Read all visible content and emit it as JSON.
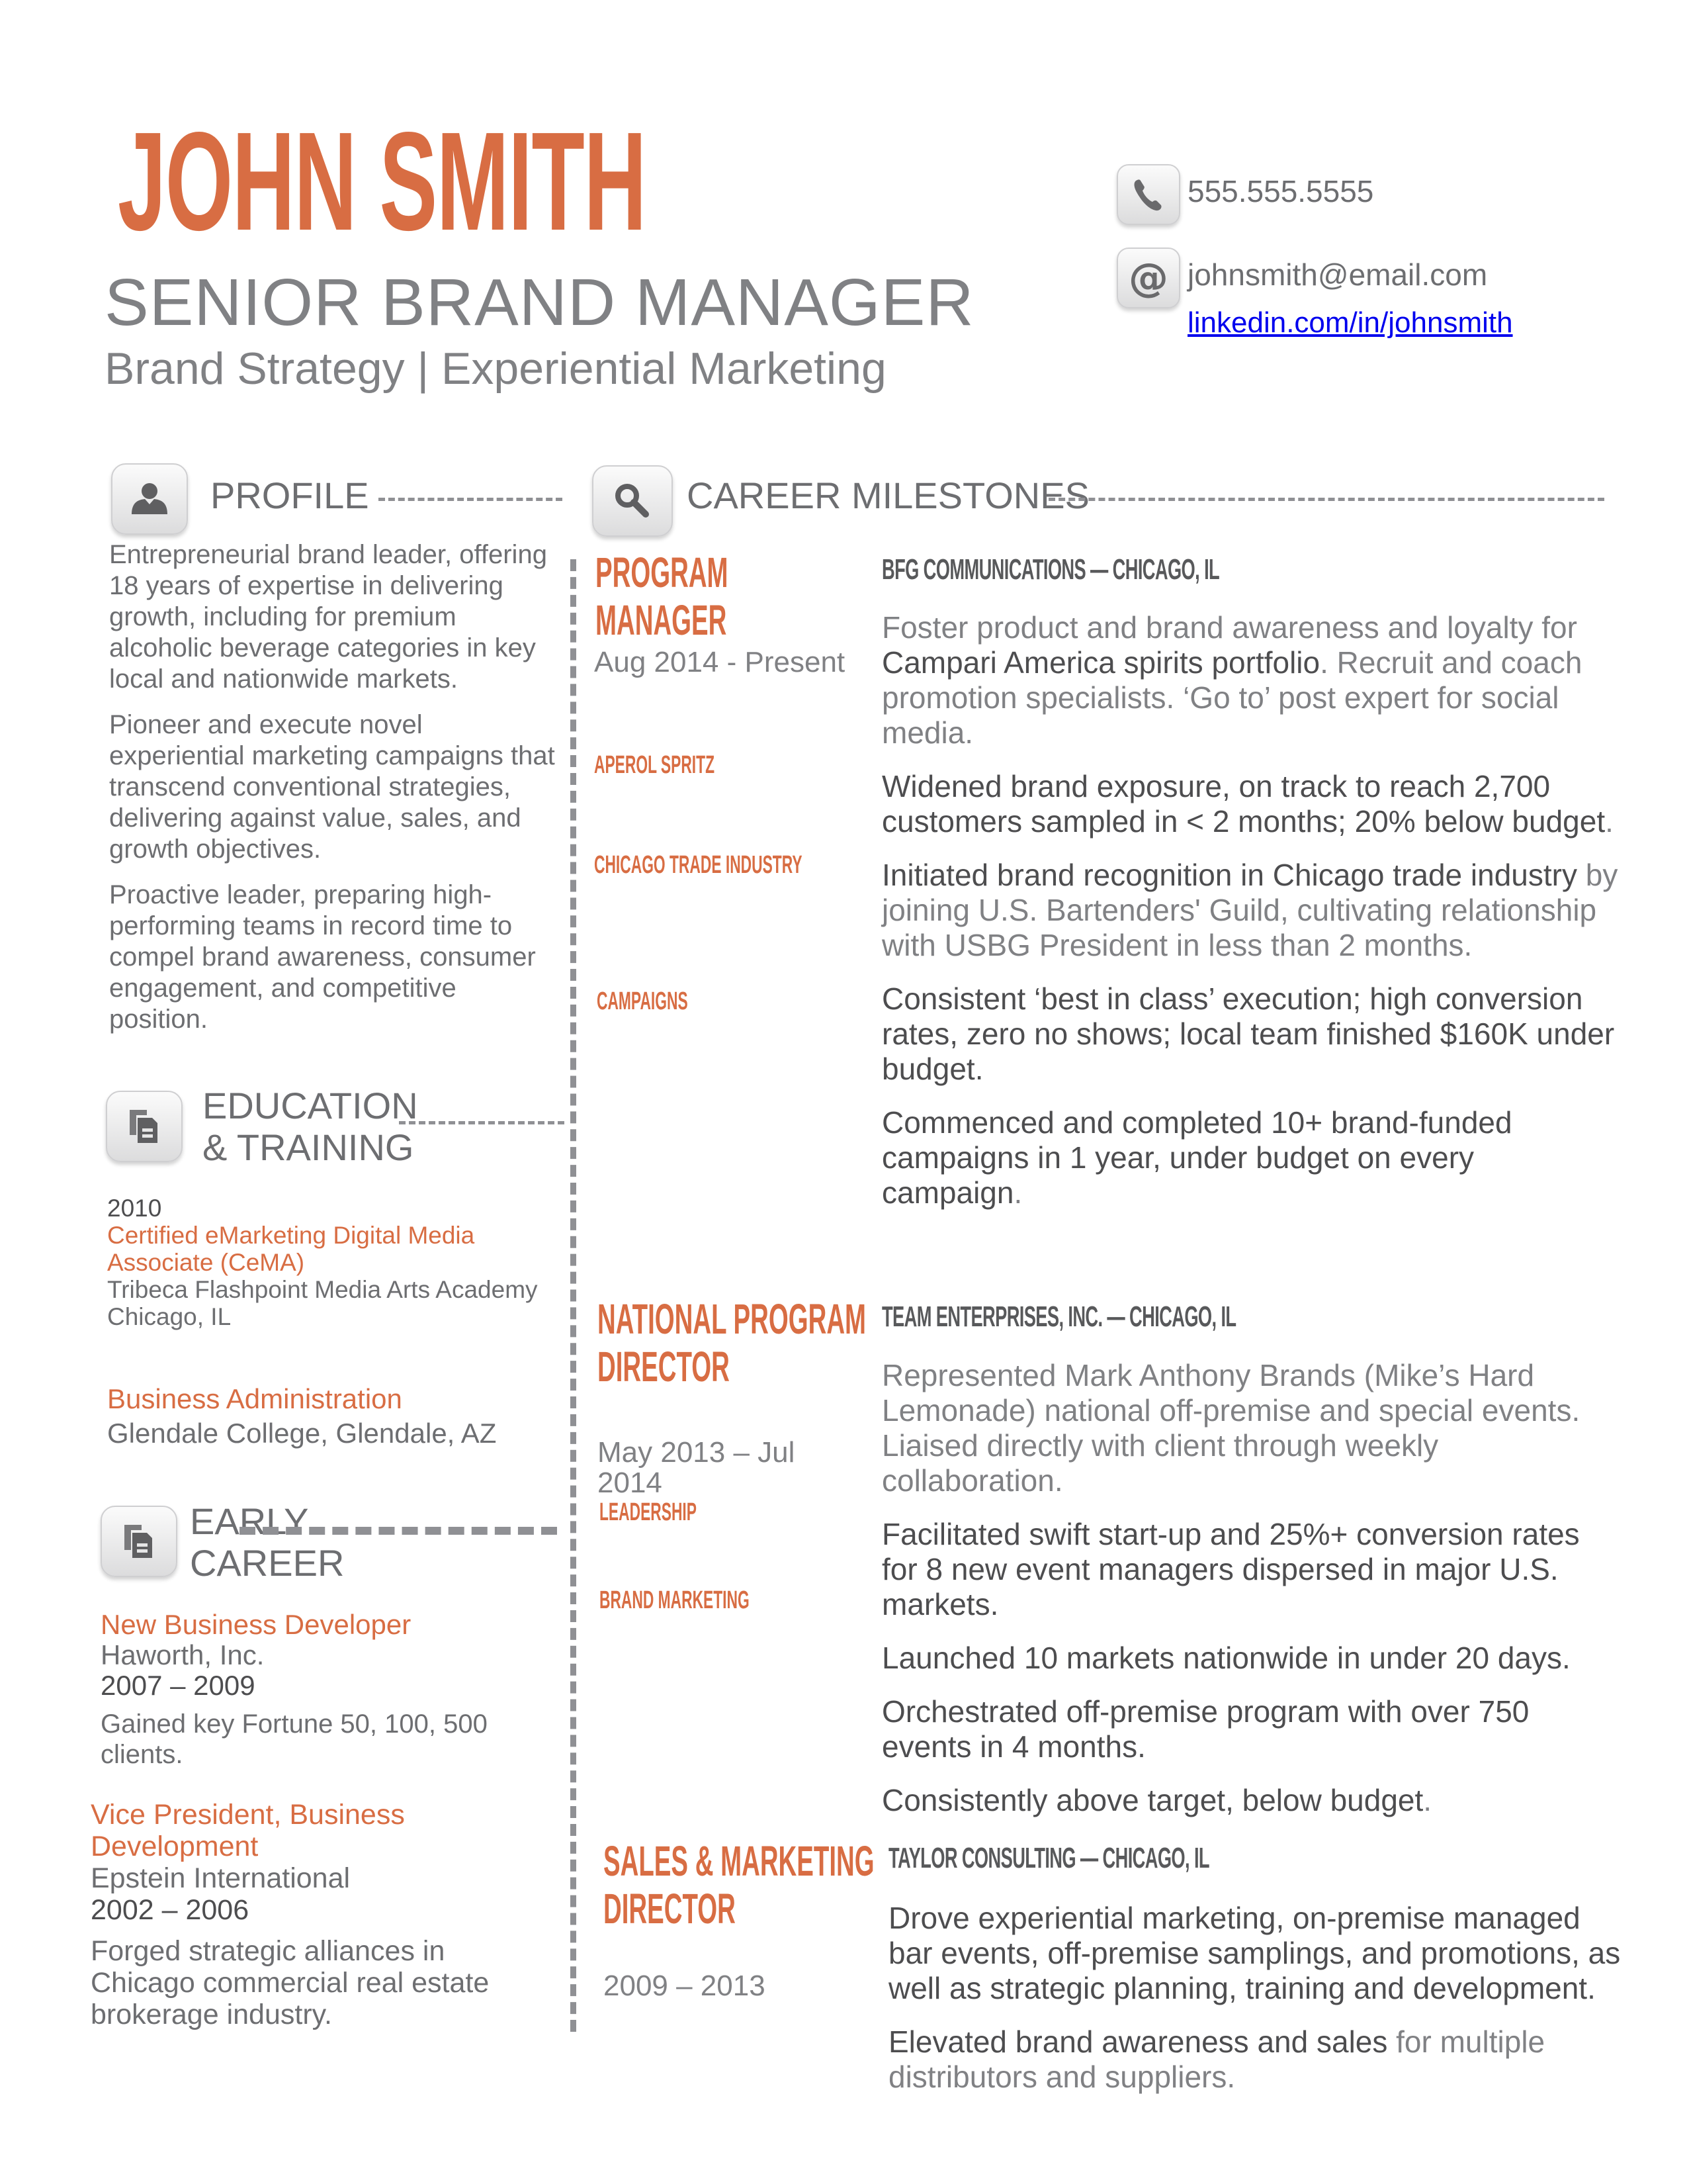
{
  "header": {
    "name": "JOHN SMITH",
    "title": "SENIOR BRAND MANAGER",
    "subtitle": "Brand Strategy | Experiential Marketing"
  },
  "contact": {
    "phone": "555.555.5555",
    "phone_icon": "phone-icon",
    "email": "johnsmith@email.com",
    "email_icon": "at-sign-icon",
    "linkedin": "linkedin.com/in/johnsmith"
  },
  "colors": {
    "accent": "#d86d43",
    "text": "#6d6e71",
    "rule": "#8f9094",
    "link": "#0000ee"
  },
  "profile": {
    "heading": "PROFILE",
    "icon": "person-icon",
    "paragraphs": [
      "Entrepreneurial brand leader, offering 18 years of expertise in delivering growth, including for premium alcoholic beverage categories in key local and nationwide markets.",
      "Pioneer and execute novel experiential marketing  campaigns that transcend conventional strategies, delivering against value, sales, and growth objectives.",
      "Proactive leader, preparing high-performing teams in record time to compel brand awareness, consumer engagement, and competitive position."
    ]
  },
  "education": {
    "heading_line1": "EDUCATION",
    "heading_line2": "& TRAINING",
    "icon": "documents-icon",
    "items": [
      {
        "year": "2010",
        "credential": "Certified eMarketing Digital Media Associate (CeMA)",
        "institution": "Tribeca Flashpoint Media Arts Academy",
        "location": "Chicago, IL"
      },
      {
        "credential": "Business Administration",
        "institution": "Glendale College, Glendale, AZ"
      }
    ]
  },
  "early_career": {
    "heading_line1": "EARLY",
    "heading_line2": "CAREER",
    "icon": "documents-icon",
    "jobs": [
      {
        "title": "New Business Developer",
        "company": "Haworth, Inc.",
        "dates": "2007 – 2009",
        "summary": "Gained key Fortune 50, 100, 500 clients."
      },
      {
        "title": "Vice President, Business Development",
        "company": "Epstein International",
        "dates": "2002 – 2006",
        "summary": "Forged strategic alliances in Chicago commercial real estate brokerage industry."
      }
    ]
  },
  "milestones": {
    "heading": "CAREER MILESTONES",
    "icon": "magnifier-icon",
    "jobs": [
      {
        "role_line1": "PROGRAM",
        "role_line2": "MANAGER",
        "dates": "Aug 2014 - Present",
        "tags": [
          "APEROL SPRITZ",
          "CHICAGO TRADE INDUSTRY",
          "CAMPAIGNS"
        ],
        "company": "BFG COMMUNICATIONS — CHICAGO, IL",
        "bullets": [
          {
            "pre": "Foster product and brand awareness and loyalty for ",
            "strong": "Campari America spirits portfolio",
            "post": ". Recruit and coach promotion specialists. ‘Go to’ post expert for social media."
          },
          {
            "strong": "Widened brand exposure, on track to reach 2,700 customers sampled in < 2 months; 20% below budget",
            "post": "."
          },
          {
            "strong": "Initiated brand recognition in Chicago trade industry",
            "post": " by joining U.S. Bartenders' Guild, cultivating relationship with USBG President in less than 2 months."
          },
          {
            "strong": "Consistent ‘best in class’ execution; high conversion rates, zero no shows; local team finished $160K under budget."
          },
          {
            "strong": "Commenced and completed 10+ brand-funded campaigns in 1 year, under budget on every campaign",
            "post": "."
          }
        ]
      },
      {
        "role_line1": "NATIONAL PROGRAM",
        "role_line2": "DIRECTOR",
        "dates_line1": "May 2013 – Jul",
        "dates_line2": "2014",
        "tags": [
          "LEADERSHIP",
          "BRAND MARKETING"
        ],
        "company": "TEAM ENTERPRISES, INC. — CHICAGO, IL",
        "bullets": [
          {
            "post": "Represented Mark Anthony Brands (Mike’s Hard Lemonade) national off-premise and special events. Liaised directly with client through weekly collaboration."
          },
          {
            "strong": "Facilitated swift start-up and 25%+ conversion rates for 8 new event managers dispersed in major U.S. markets."
          },
          {
            "strong": "Launched 10 markets nationwide in under 20 days."
          },
          {
            "strong": "Orchestrated off-premise program with over 750 events in 4 months."
          },
          {
            "strong": "Consistently above target, below budget",
            "post": "."
          }
        ]
      },
      {
        "role_line1": "SALES & MARKETING",
        "role_line2": "DIRECTOR",
        "dates": "2009 – 2013",
        "company": "TAYLOR CONSULTING — CHICAGO, IL",
        "bullets": [
          {
            "strong": "Drove experiential marketing, on-premise managed bar events, off-premise samplings, and promotions, as well as strategic planning, training and development."
          },
          {
            "strong": "Elevated brand awareness and sales",
            "post": " for multiple distributors and suppliers."
          }
        ]
      }
    ]
  }
}
